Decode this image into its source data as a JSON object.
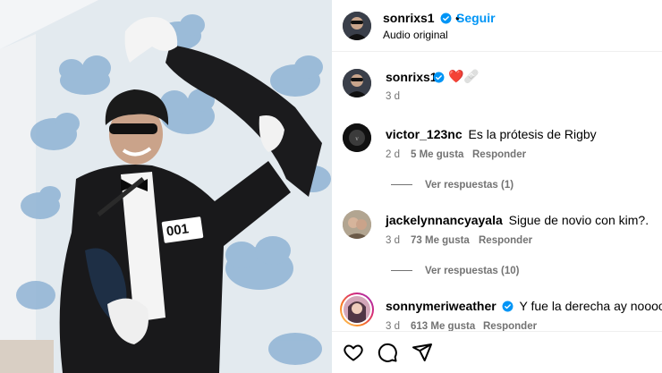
{
  "post_author": {
    "username": "sonrixs1",
    "follow_label": "Seguir",
    "audio": "Audio original",
    "separator": "•"
  },
  "caption": {
    "username": "sonrixs1",
    "emoji": "❤️🩹",
    "age": "3 d"
  },
  "comments": [
    {
      "username": "victor_123nc",
      "text": "Es la prótesis de Rigby",
      "age": "2 d",
      "likes": "5 Me gusta",
      "reply_label": "Responder",
      "view_replies": "Ver respuestas (1)"
    },
    {
      "username": "jackelynnancyayala",
      "text": "Sigue de novio con kim?.",
      "age": "3 d",
      "likes": "73 Me gusta",
      "reply_label": "Responder",
      "view_replies": "Ver respuestas (10)"
    },
    {
      "username": "sonnymeriweather",
      "text": "Y fue la derecha ay nooooo",
      "age": "3 d",
      "likes": "613 Me gusta",
      "reply_label": "Responder"
    }
  ],
  "photo": {
    "badge_number": "001"
  },
  "icons": {
    "verified": "verified-badge-icon",
    "like": "heart-icon",
    "comment": "comment-bubble-icon",
    "share": "paper-plane-icon"
  },
  "colors": {
    "accent": "#0095f6",
    "muted": "#737373",
    "wall": "#dfe8ee",
    "cloud": "#8fb6d8"
  }
}
